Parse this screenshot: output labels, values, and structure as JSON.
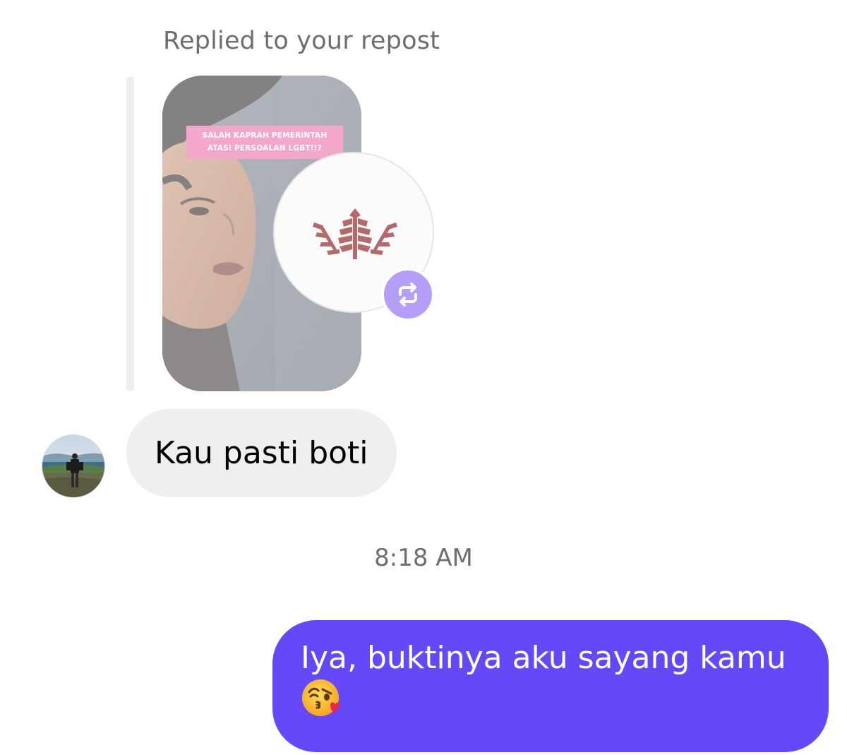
{
  "thread": {
    "reply_context": "Replied to your repost",
    "repost_card": {
      "caption_line1": "SALAH KAPRAH PEMERINTAH",
      "caption_line2": "ATASI PERSOALAN LGBT!!?",
      "caption_bg_color": "#f3a8c9",
      "profile_logo_icon": "wheat-leaf-logo",
      "logo_color": "#b46a6a",
      "badge_icon": "repost-icon",
      "badge_color": "#b59ef8"
    },
    "incoming_message": {
      "text": "Kau pasti boti",
      "bubble_color": "#efefef"
    },
    "timestamp": "8:18 AM",
    "outgoing_message": {
      "text": "Iya, buktinya aku sayang kamu",
      "emoji": "face-blowing-a-kiss-emoji",
      "bubble_color": "#6548f8"
    }
  }
}
